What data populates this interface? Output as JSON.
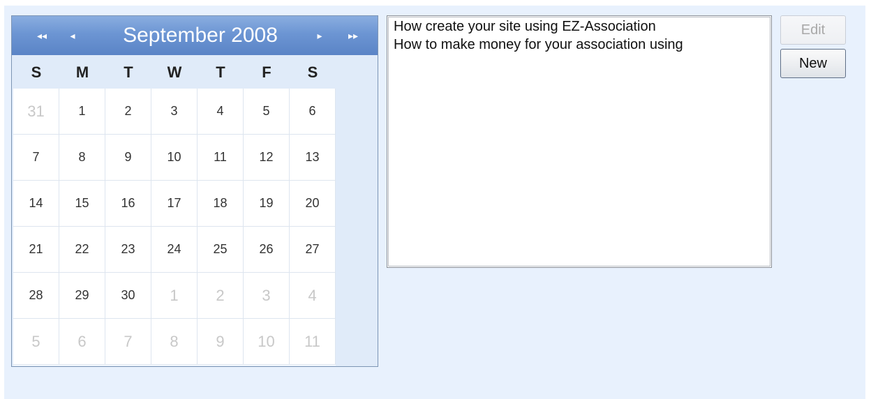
{
  "calendar": {
    "title": "September 2008",
    "nav": {
      "prev_year": "◂◂",
      "prev_month": "◂",
      "next_month": "▸",
      "next_year": "▸▸"
    },
    "weekdays": [
      "S",
      "M",
      "T",
      "W",
      "T",
      "F",
      "S"
    ],
    "weeks": [
      [
        {
          "d": "31",
          "o": true
        },
        {
          "d": "1"
        },
        {
          "d": "2"
        },
        {
          "d": "3"
        },
        {
          "d": "4"
        },
        {
          "d": "5"
        },
        {
          "d": "6"
        }
      ],
      [
        {
          "d": "7"
        },
        {
          "d": "8"
        },
        {
          "d": "9"
        },
        {
          "d": "10"
        },
        {
          "d": "11"
        },
        {
          "d": "12"
        },
        {
          "d": "13"
        }
      ],
      [
        {
          "d": "14"
        },
        {
          "d": "15"
        },
        {
          "d": "16"
        },
        {
          "d": "17"
        },
        {
          "d": "18"
        },
        {
          "d": "19"
        },
        {
          "d": "20"
        }
      ],
      [
        {
          "d": "21"
        },
        {
          "d": "22"
        },
        {
          "d": "23"
        },
        {
          "d": "24"
        },
        {
          "d": "25"
        },
        {
          "d": "26"
        },
        {
          "d": "27"
        }
      ],
      [
        {
          "d": "28"
        },
        {
          "d": "29"
        },
        {
          "d": "30"
        },
        {
          "d": "1",
          "o": true
        },
        {
          "d": "2",
          "o": true
        },
        {
          "d": "3",
          "o": true
        },
        {
          "d": "4",
          "o": true
        }
      ],
      [
        {
          "d": "5",
          "o": true
        },
        {
          "d": "6",
          "o": true
        },
        {
          "d": "7",
          "o": true
        },
        {
          "d": "8",
          "o": true
        },
        {
          "d": "9",
          "o": true
        },
        {
          "d": "10",
          "o": true
        },
        {
          "d": "11",
          "o": true
        }
      ]
    ]
  },
  "list": {
    "items": [
      "How create your site using EZ-Association",
      "How to make money for your association using"
    ]
  },
  "buttons": {
    "edit_label": "Edit",
    "new_label": "New"
  },
  "colors": {
    "panel_bg": "#e8f1fd",
    "header_accent": "#6c95d3"
  }
}
